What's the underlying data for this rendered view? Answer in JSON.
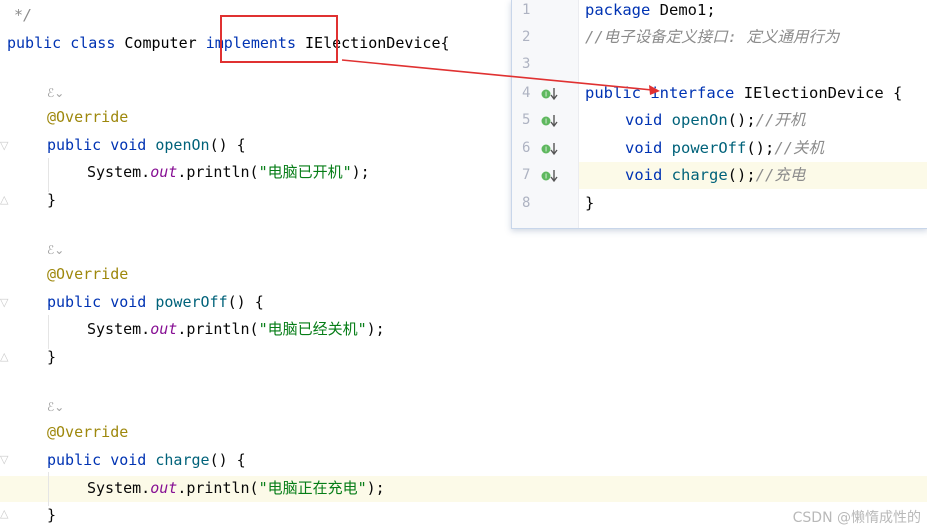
{
  "editor": {
    "line_comment_end": "*/",
    "class_decl": {
      "kw_public": "public",
      "kw_class": "class",
      "class_name": "Computer",
      "kw_implements": "implements",
      "interface_name": "IElectionDevice",
      "brace_open": "{"
    },
    "methods": [
      {
        "annotation": "@Override",
        "kw_public": "public",
        "kw_void": "void",
        "name": "openOn",
        "params": "() {",
        "call_prefix": "System.",
        "call_field": "out",
        "call_method": ".println(",
        "call_string": "\"电脑已开机\"",
        "call_suffix": ");",
        "brace_close": "}"
      },
      {
        "annotation": "@Override",
        "kw_public": "public",
        "kw_void": "void",
        "name": "powerOff",
        "params": "() {",
        "call_prefix": "System.",
        "call_field": "out",
        "call_method": ".println(",
        "call_string": "\"电脑已经关机\"",
        "call_suffix": ");",
        "brace_close": "}"
      },
      {
        "annotation": "@Override",
        "kw_public": "public",
        "kw_void": "void",
        "name": "charge",
        "params": "() {",
        "call_prefix": "System.",
        "call_field": "out",
        "call_method": ".println(",
        "call_string": "\"电脑正在充电\"",
        "call_suffix": ");",
        "brace_close": "}"
      }
    ],
    "inlay_hint": "ℰ⌄"
  },
  "popup": {
    "line_numbers": [
      "1",
      "2",
      "3",
      "4",
      "5",
      "6",
      "7",
      "8"
    ],
    "package_kw": "package",
    "package_name": "Demo1;",
    "comment": "//电子设备定义接口: 定义通用行为",
    "iface_kw_public": "public",
    "iface_kw_interface": "interface",
    "iface_name": "IElectionDevice {",
    "methods": [
      {
        "kw": "void",
        "name": "openOn",
        "tail": "();",
        "comment": "//开机"
      },
      {
        "kw": "void",
        "name": "powerOff",
        "tail": "();",
        "comment": "//关机"
      },
      {
        "kw": "void",
        "name": "charge",
        "tail": "();",
        "comment": "//充电"
      }
    ],
    "close_brace": "}"
  },
  "watermark": "CSDN @懒惰成性的",
  "colors": {
    "highlight_box": "#e03131",
    "arrow": "#e03131",
    "keyword": "#0033b3",
    "string": "#067d17",
    "annotation": "#9e880d"
  }
}
